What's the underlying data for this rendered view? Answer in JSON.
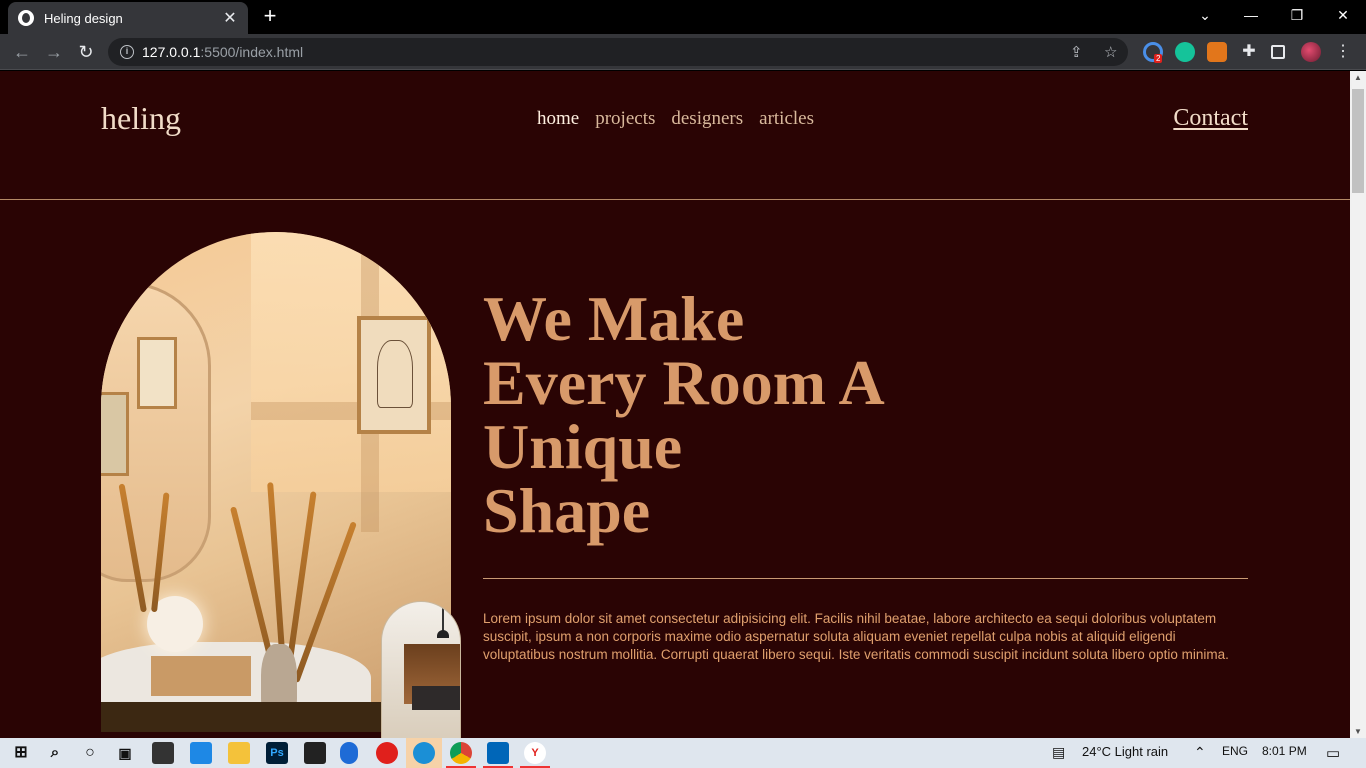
{
  "browser": {
    "tab_title": "Heling design",
    "url_host": "127.0.0.1",
    "url_path": ":5500/index.html",
    "new_tab": "+",
    "close": "✕"
  },
  "site": {
    "logo": "heling",
    "nav": [
      {
        "label": "home",
        "active": true
      },
      {
        "label": "projects",
        "active": false
      },
      {
        "label": "designers",
        "active": false
      },
      {
        "label": "articles",
        "active": false
      }
    ],
    "contact": "Contact",
    "headline_lines": [
      "We Make",
      "Every Room A",
      "Unique",
      "Shape"
    ],
    "lead": "Lorem ipsum dolor sit amet consectetur adipisicing elit. Facilis nihil beatae, labore architecto ea sequi doloribus voluptatem suscipit, ipsum a non corporis maxime odio aspernatur soluta aliquam eveniet repellat culpa nobis at aliquid eligendi voluptatibus nostrum mollitia. Corrupti quaerat libero sequi. Iste veritatis commodi suscipit incidunt soluta libero optio minima."
  },
  "colors": {
    "page_bg": "#2a0404",
    "accent": "#d89a6a",
    "logo": "#f1dcc8"
  },
  "taskbar": {
    "weather": "24°C  Light rain",
    "language": "ENG",
    "time": "8:01 PM",
    "extension_badge": "2"
  }
}
